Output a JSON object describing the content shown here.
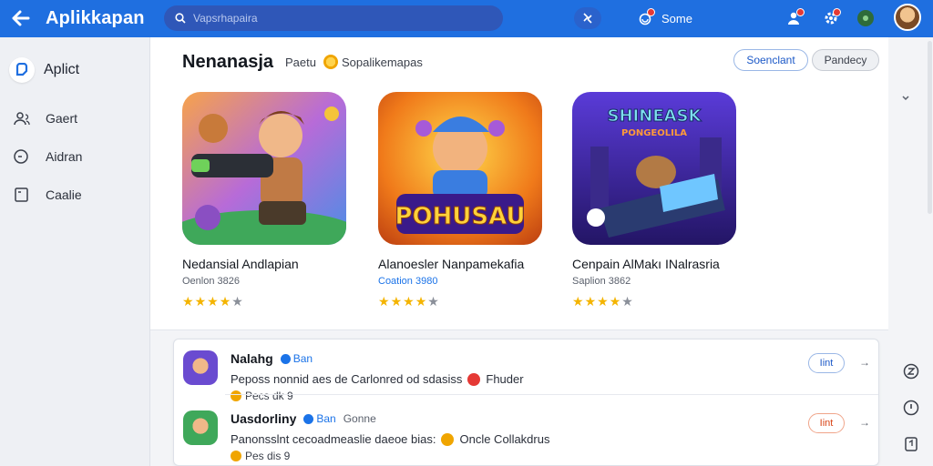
{
  "topbar": {
    "back_icon": "arrow-left-icon",
    "app_title": "Aplikkapan",
    "search_placeholder": "Vapsrhapaira",
    "filter_icon": "sort-icon",
    "notification_label": "Some",
    "icons": [
      "add-user-icon",
      "settings-gear-icon",
      "record-icon"
    ]
  },
  "sidebar": {
    "brand": "Aplict",
    "items": [
      {
        "label": "Gaert",
        "icon": "people-icon"
      },
      {
        "label": "Aidran",
        "icon": "clock-icon"
      },
      {
        "label": "Caalie",
        "icon": "square-icon"
      }
    ]
  },
  "main": {
    "title": "Nenanasja",
    "meta_prefix": "Paetu",
    "meta_label": "Sopalikemapas",
    "primary_button": "Soenclant",
    "secondary_button": "Pandecy",
    "games": [
      {
        "name": "Nedansial Andlapian",
        "sub": "Oenlon 3826",
        "sub_color": "#5a606c",
        "rating": 4
      },
      {
        "name": "Alanoesler Nanpamekafia",
        "sub": "Coation 3980",
        "sub_color": "#1b73e8",
        "rating": 4
      },
      {
        "name": "Cenpain AlMakı INalrasria",
        "sub": "Saplion 3862",
        "sub_color": "#5a606c",
        "rating": 4
      },
      {
        "art_text": "POHUSAU"
      },
      {
        "art_text": "SHINEASK",
        "art_subtext": "PONGEOLILA"
      }
    ]
  },
  "list": [
    {
      "title": "Nalahg",
      "verified": "Ban",
      "tag": "",
      "desc": "Peposs nonnid aes de Carlonred od sdasiss",
      "badge": "Fhuder",
      "badge_color": "#e53935",
      "stat": "Pecs dk 9",
      "button": "Iint",
      "button_color": "#1b58c7",
      "button_border": "#9ab7e6"
    },
    {
      "title": "Uasdorliny",
      "verified": "Ban",
      "tag": "Gonne",
      "desc": "Panonsslnt cecoadmeaslie daeoe bias:",
      "badge": "Oncle Collakdrus",
      "badge_color": "#f0a500",
      "stat": "Pes dis 9",
      "button": "Iint",
      "button_color": "#d84315",
      "button_border": "#f0a58a"
    }
  ],
  "colors": {
    "brand": "#1f6fe0",
    "star": "#f4b400"
  }
}
